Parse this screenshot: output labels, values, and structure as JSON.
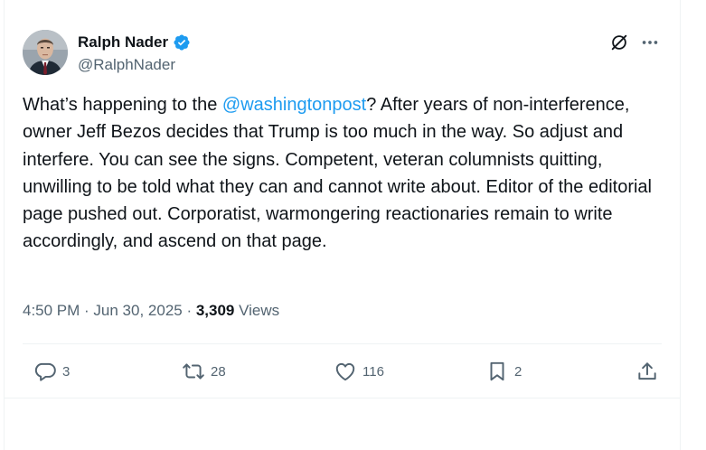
{
  "author": {
    "name": "Ralph Nader",
    "handle": "@RalphNader"
  },
  "tweet": {
    "mention": "@washingtonpost",
    "text_before": "What’s happening to the ",
    "text_after": "? After years of non-interference, owner Jeff Bezos decides that Trump is too much in the way. So adjust and interfere. You can see the signs. Competent, veteran columnists quitting, unwilling to be told what they can and cannot write about. Editor of the editorial page pushed out. Corporatist, warmongering reactionaries remain to write accordingly, and ascend on that page."
  },
  "meta": {
    "time": "4:50 PM",
    "sep1": " · ",
    "date": "Jun 30, 2025",
    "sep2": " · ",
    "views_count": "3,309",
    "views_label": " Views"
  },
  "actions": {
    "replies": "3",
    "reposts": "28",
    "likes": "116",
    "bookmarks": "2"
  },
  "icons": {
    "verified": "verified-badge-icon",
    "grok": "grok-icon",
    "more": "more-icon",
    "reply": "reply-icon",
    "repost": "repost-icon",
    "like": "heart-icon",
    "bookmark": "bookmark-icon",
    "share": "share-icon"
  },
  "colors": {
    "link": "#1d9bf0",
    "secondary_text": "#536471",
    "primary_text": "#0f1419",
    "border": "#eff3f4"
  }
}
